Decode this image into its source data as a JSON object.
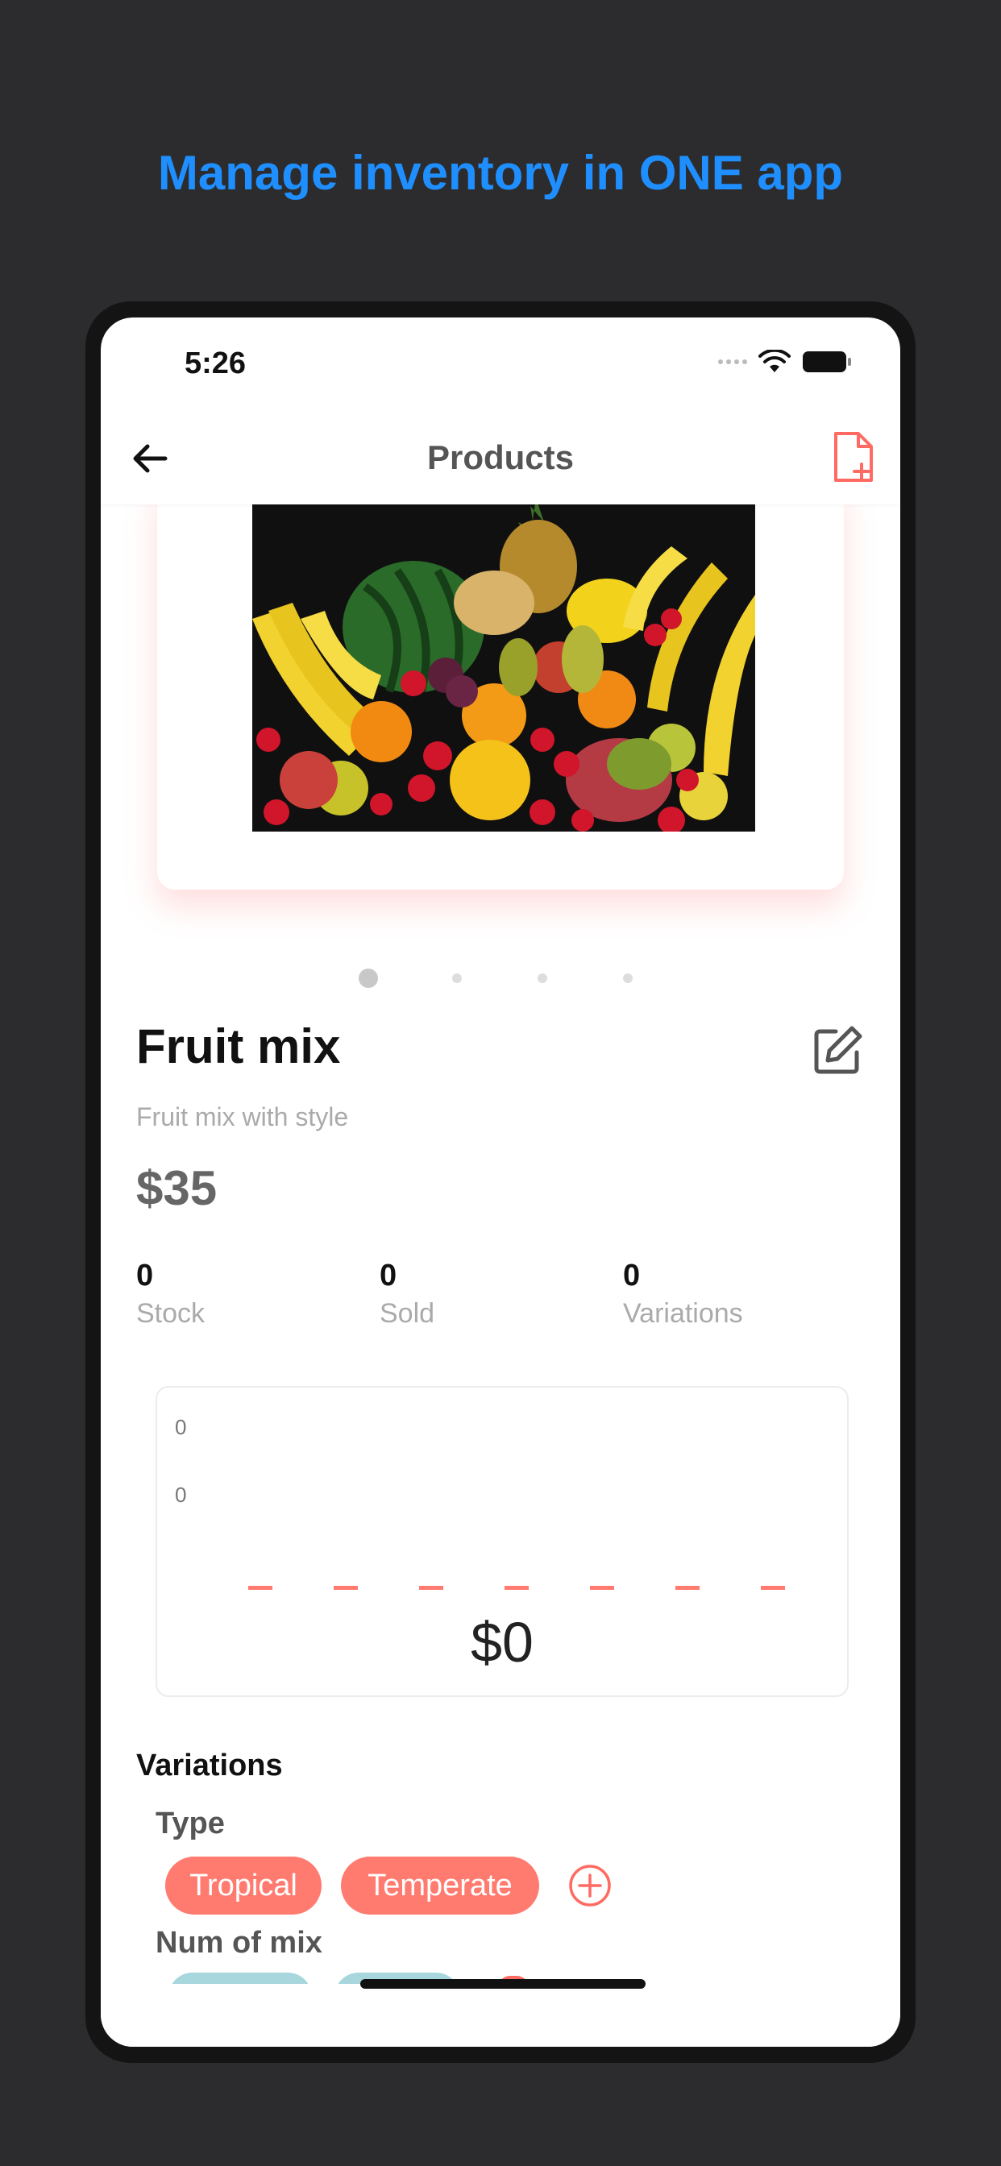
{
  "headline": "Manage inventory in ONE app",
  "status_bar": {
    "time": "5:26"
  },
  "nav": {
    "title": "Products"
  },
  "product": {
    "name": "Fruit mix",
    "description": "Fruit mix with style",
    "price": "$35",
    "image_count": 4,
    "active_image": 1
  },
  "stats": [
    {
      "value": "0",
      "label": "Stock"
    },
    {
      "value": "0",
      "label": "Sold"
    },
    {
      "value": "0",
      "label": "Variations"
    }
  ],
  "chart": {
    "y_labels": [
      "0",
      "0"
    ],
    "total": "$0",
    "bar_count": 7
  },
  "variations": {
    "title": "Variations",
    "groups": [
      {
        "label": "Type",
        "options": [
          "Tropical",
          "Temperate"
        ]
      },
      {
        "label": "Num of mix",
        "options": []
      }
    ]
  },
  "colors": {
    "accent": "#ff7b70",
    "headline": "#1f8fff",
    "teal": "#a7d6dd"
  }
}
